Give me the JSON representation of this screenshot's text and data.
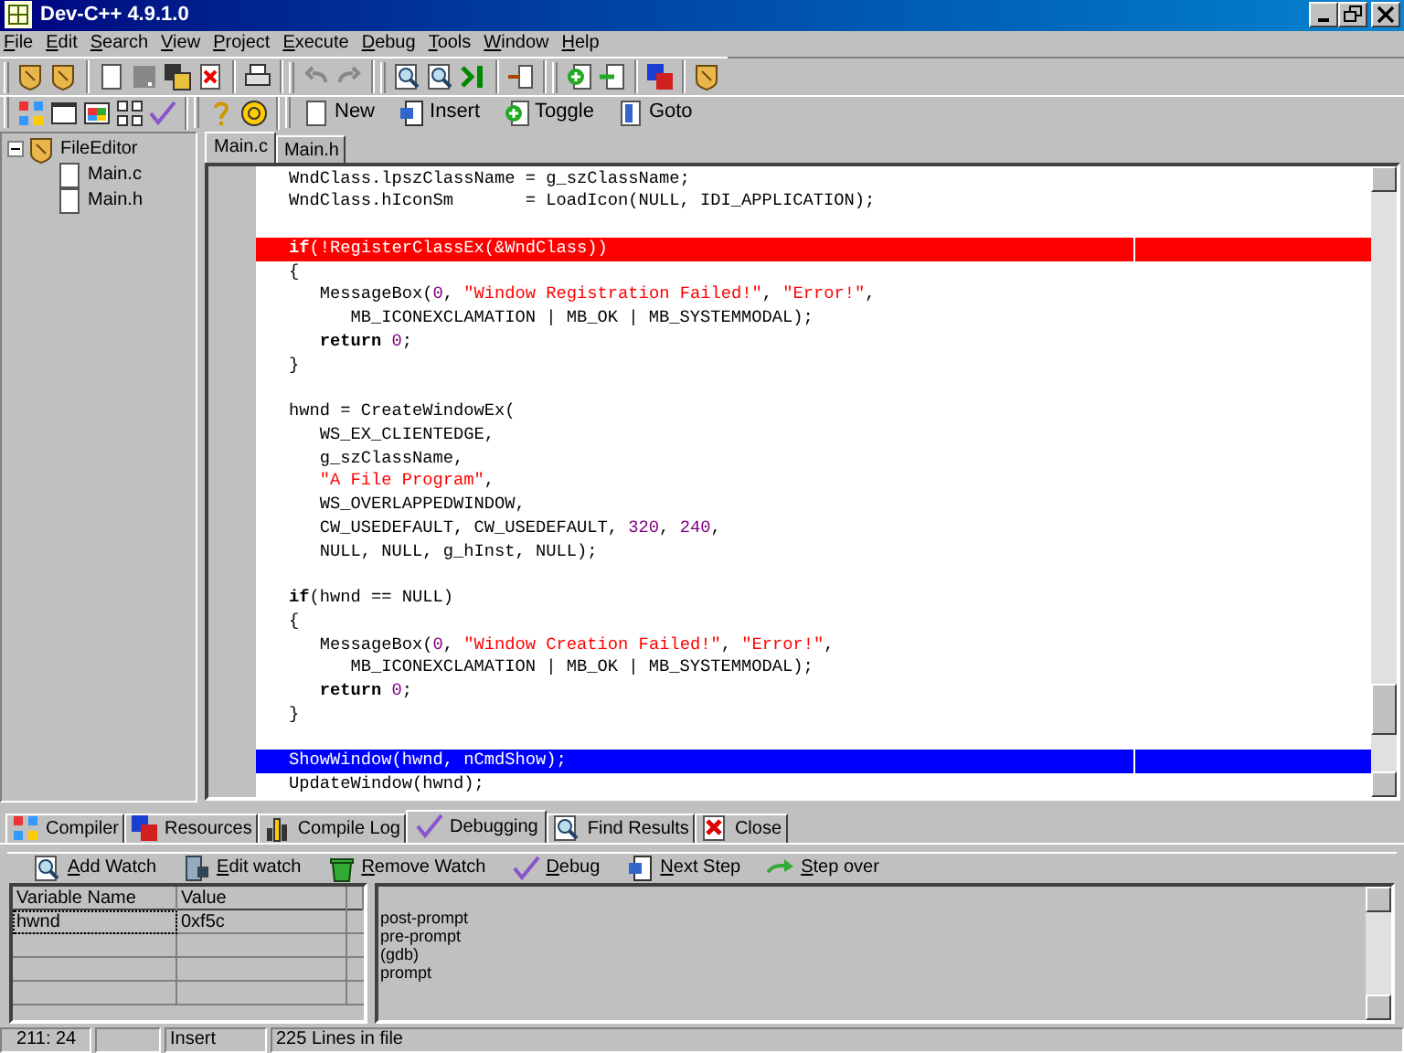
{
  "window": {
    "title": "Dev-C++ 4.9.1.0"
  },
  "menu": [
    "File",
    "Edit",
    "Search",
    "View",
    "Project",
    "Execute",
    "Debug",
    "Tools",
    "Window",
    "Help"
  ],
  "toolbar_buttons": [
    "New",
    "Insert",
    "Toggle",
    "Goto"
  ],
  "project_tree": [
    {
      "label": "FileEditor",
      "expanded": true,
      "children": [
        {
          "label": "Main.c"
        },
        {
          "label": "Main.h"
        }
      ]
    }
  ],
  "editor_tabs": [
    {
      "label": "Main.c",
      "selected": true
    },
    {
      "label": "Main.h",
      "selected": false
    }
  ],
  "code_lines": [
    {
      "breakpoint": false,
      "current": false,
      "segments": [
        {
          "text": "WndClass.lpszClassName = g_szClassName;",
          "kind": "plain"
        }
      ]
    },
    {
      "breakpoint": false,
      "current": false,
      "segments": [
        {
          "text": "WndClass.hIconSm       = LoadIcon(NULL, IDI_APPLICATION);",
          "kind": "plain"
        }
      ]
    },
    {
      "breakpoint": false,
      "current": false
    },
    {
      "breakpoint": true,
      "current": false,
      "segments": [
        {
          "text": "if",
          "kind": "keyword"
        },
        {
          "text": "(!RegisterClassEx(&WndClass))",
          "kind": "plain"
        }
      ]
    },
    {
      "breakpoint": false,
      "current": false,
      "segments": [
        {
          "text": "{",
          "kind": "plain"
        }
      ]
    },
    {
      "breakpoint": false,
      "current": false,
      "segments": [
        {
          "text": "   MessageBox(",
          "kind": "plain"
        },
        {
          "text": "0",
          "kind": "number"
        },
        {
          "text": ", ",
          "kind": "plain"
        },
        {
          "text": "\"Window Registration Failed!\"",
          "kind": "string"
        },
        {
          "text": ", ",
          "kind": "plain"
        },
        {
          "text": "\"Error!\"",
          "kind": "string"
        },
        {
          "text": ",",
          "kind": "plain"
        }
      ]
    },
    {
      "breakpoint": false,
      "current": false,
      "segments": [
        {
          "text": "      MB_ICONEXCLAMATION | MB_OK | MB_SYSTEMMODAL);",
          "kind": "plain"
        }
      ]
    },
    {
      "breakpoint": false,
      "current": false,
      "segments": [
        {
          "text": "   return",
          "kind": "keyword"
        },
        {
          "text": " 0",
          "kind": "number"
        },
        {
          "text": ";",
          "kind": "plain"
        }
      ]
    },
    {
      "breakpoint": false,
      "current": false,
      "segments": [
        {
          "text": "}",
          "kind": "plain"
        }
      ]
    },
    {
      "breakpoint": false,
      "current": false
    },
    {
      "breakpoint": false,
      "current": false,
      "segments": [
        {
          "text": "hwnd = CreateWindowEx(",
          "kind": "plain"
        }
      ]
    },
    {
      "breakpoint": false,
      "current": false,
      "segments": [
        {
          "text": "   WS_EX_CLIENTEDGE,",
          "kind": "plain"
        }
      ]
    },
    {
      "breakpoint": false,
      "current": false,
      "segments": [
        {
          "text": "   g_szClassName,",
          "kind": "plain"
        }
      ]
    },
    {
      "breakpoint": false,
      "current": false,
      "segments": [
        {
          "text": "   \"A File Program\"",
          "kind": "string"
        },
        {
          "text": ",",
          "kind": "plain"
        }
      ]
    },
    {
      "breakpoint": false,
      "current": false,
      "segments": [
        {
          "text": "   WS_OVERLAPPEDWINDOW,",
          "kind": "plain"
        }
      ]
    },
    {
      "breakpoint": false,
      "current": false,
      "segments": [
        {
          "text": "   CW_USEDEFAULT, CW_USEDEFAULT, ",
          "kind": "plain"
        },
        {
          "text": "320",
          "kind": "number"
        },
        {
          "text": ", ",
          "kind": "plain"
        },
        {
          "text": "240",
          "kind": "number"
        },
        {
          "text": ",",
          "kind": "plain"
        }
      ]
    },
    {
      "breakpoint": false,
      "current": false,
      "segments": [
        {
          "text": "   NULL, NULL, g_hInst, NULL);",
          "kind": "plain"
        }
      ]
    },
    {
      "breakpoint": false,
      "current": false
    },
    {
      "breakpoint": false,
      "current": false,
      "segments": [
        {
          "text": "if",
          "kind": "keyword"
        },
        {
          "text": "(hwnd == NULL)",
          "kind": "plain"
        }
      ]
    },
    {
      "breakpoint": false,
      "current": false,
      "segments": [
        {
          "text": "{",
          "kind": "plain"
        }
      ]
    },
    {
      "breakpoint": false,
      "current": false,
      "segments": [
        {
          "text": "   MessageBox(",
          "kind": "plain"
        },
        {
          "text": "0",
          "kind": "number"
        },
        {
          "text": ", ",
          "kind": "plain"
        },
        {
          "text": "\"Window Creation Failed!\"",
          "kind": "string"
        },
        {
          "text": ", ",
          "kind": "plain"
        },
        {
          "text": "\"Error!\"",
          "kind": "string"
        },
        {
          "text": ",",
          "kind": "plain"
        }
      ]
    },
    {
      "breakpoint": false,
      "current": false,
      "segments": [
        {
          "text": "      MB_ICONEXCLAMATION | MB_OK | MB_SYSTEMMODAL);",
          "kind": "plain"
        }
      ]
    },
    {
      "breakpoint": false,
      "current": false,
      "segments": [
        {
          "text": "   return",
          "kind": "keyword"
        },
        {
          "text": " 0",
          "kind": "number"
        },
        {
          "text": ";",
          "kind": "plain"
        }
      ]
    },
    {
      "breakpoint": false,
      "current": false,
      "segments": [
        {
          "text": "}",
          "kind": "plain"
        }
      ]
    },
    {
      "breakpoint": false,
      "current": false
    },
    {
      "breakpoint": false,
      "current": true,
      "segments": [
        {
          "text": "ShowWindow(hwnd, nCmdShow);",
          "kind": "plain"
        }
      ]
    },
    {
      "breakpoint": false,
      "current": false,
      "segments": [
        {
          "text": "UpdateWindow(hwnd);",
          "kind": "plain"
        }
      ]
    }
  ],
  "bottom_tabs": [
    {
      "label": "Compiler",
      "selected": false
    },
    {
      "label": "Resources",
      "selected": false
    },
    {
      "label": "Compile Log",
      "selected": false
    },
    {
      "label": "Debugging",
      "selected": true
    },
    {
      "label": "Find Results",
      "selected": false
    },
    {
      "label": "Close",
      "selected": false
    }
  ],
  "debug_buttons": [
    "Add Watch",
    "Edit watch",
    "Remove Watch",
    "Debug",
    "Next Step",
    "Step over"
  ],
  "watch_table": {
    "columns": [
      "Variable Name",
      "Value"
    ],
    "rows": [
      [
        "hwnd",
        "0xf5c"
      ]
    ]
  },
  "debug_output": [
    "post-prompt",
    "pre-prompt",
    "(gdb)",
    "prompt"
  ],
  "status_bar": {
    "position": "211: 24",
    "mode": "Insert",
    "info": "225 Lines in file"
  }
}
